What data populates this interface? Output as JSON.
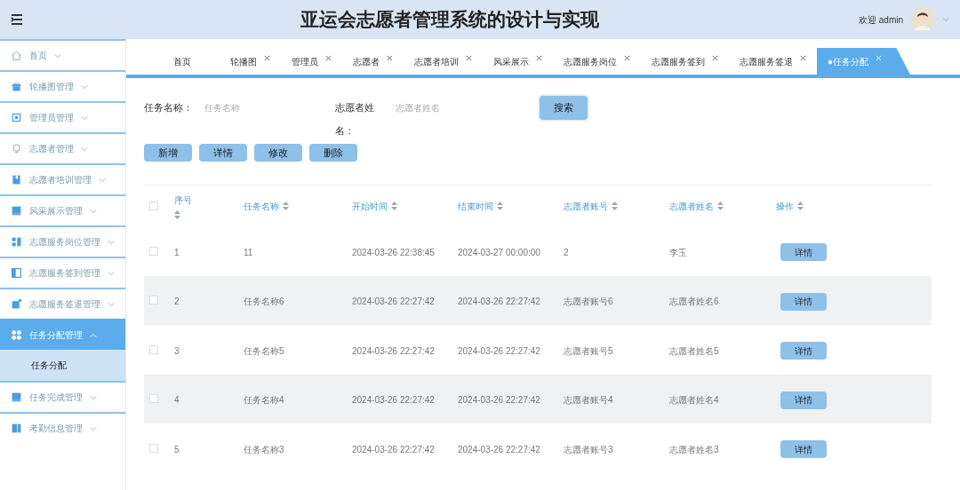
{
  "header": {
    "title": "亚运会志愿者管理系统的设计与实现",
    "welcome": "欢迎 admin"
  },
  "sidebar": {
    "items": [
      {
        "label": "首页",
        "kind": "home",
        "selected": false,
        "expanded": false
      },
      {
        "label": "轮播图管理",
        "kind": "gift",
        "selected": false,
        "expanded": false
      },
      {
        "label": "管理员管理",
        "kind": "chip",
        "selected": false,
        "expanded": false
      },
      {
        "label": "志愿者管理",
        "kind": "bulb",
        "selected": false,
        "expanded": false
      },
      {
        "label": "志愿者培训管理",
        "kind": "bookmark",
        "selected": false,
        "expanded": false
      },
      {
        "label": "风采展示管理",
        "kind": "monitor",
        "selected": false,
        "expanded": false
      },
      {
        "label": "志愿服务岗位管理",
        "kind": "blocks",
        "selected": false,
        "expanded": false
      },
      {
        "label": "志愿服务签到管理",
        "kind": "panel",
        "selected": false,
        "expanded": false
      },
      {
        "label": "志愿服务签退管理",
        "kind": "badge",
        "selected": false,
        "expanded": false
      },
      {
        "label": "任务分配管理",
        "kind": "grid",
        "selected": true,
        "expanded": true,
        "children": [
          {
            "label": "任务分配",
            "selected": true
          }
        ]
      },
      {
        "label": "任务完成管理",
        "kind": "monitor",
        "selected": false,
        "expanded": false
      },
      {
        "label": "考勤信息管理",
        "kind": "book",
        "selected": false,
        "expanded": false
      }
    ]
  },
  "tabs": [
    {
      "label": "首页",
      "closable": false,
      "selected": false
    },
    {
      "label": "轮播图",
      "closable": true,
      "selected": false
    },
    {
      "label": "管理员",
      "closable": true,
      "selected": false
    },
    {
      "label": "志愿者",
      "closable": true,
      "selected": false
    },
    {
      "label": "志愿者培训",
      "closable": true,
      "selected": false
    },
    {
      "label": "风采展示",
      "closable": true,
      "selected": false
    },
    {
      "label": "志愿服务岗位",
      "closable": true,
      "selected": false
    },
    {
      "label": "志愿服务签到",
      "closable": true,
      "selected": false
    },
    {
      "label": "志愿服务签退",
      "closable": true,
      "selected": false
    },
    {
      "label": "●任务分配",
      "closable": true,
      "selected": true
    }
  ],
  "search": {
    "fields": [
      {
        "label": "任务名称：",
        "placeholder": "任务名称"
      },
      {
        "label": "志愿者姓名：",
        "placeholder": "志愿者姓名"
      }
    ],
    "button": "搜索"
  },
  "actions": [
    "新增",
    "详情",
    "修改",
    "删除"
  ],
  "table": {
    "select_all_checked": false,
    "columns": [
      "序号",
      "任务名称",
      "开始时间",
      "结束时间",
      "志愿者账号",
      "志愿者姓名",
      "操作"
    ],
    "rows": [
      {
        "checked": false,
        "cells": [
          "1",
          "11",
          "2024-03-26 22:38:45",
          "2024-03-27 00:00:00",
          "2",
          "李玉"
        ],
        "action": "详情"
      },
      {
        "checked": false,
        "cells": [
          "2",
          "任务名称6",
          "2024-03-26 22:27:42",
          "2024-03-26 22:27:42",
          "志愿者账号6",
          "志愿者姓名6"
        ],
        "action": "详情"
      },
      {
        "checked": false,
        "cells": [
          "3",
          "任务名称5",
          "2024-03-26 22:27:42",
          "2024-03-26 22:27:42",
          "志愿者账号5",
          "志愿者姓名5"
        ],
        "action": "详情"
      },
      {
        "checked": false,
        "cells": [
          "4",
          "任务名称4",
          "2024-03-26 22:27:42",
          "2024-03-26 22:27:42",
          "志愿者账号4",
          "志愿者姓名4"
        ],
        "action": "详情"
      },
      {
        "checked": false,
        "cells": [
          "5",
          "任务名称3",
          "2024-03-26 22:27:42",
          "2024-03-26 22:27:42",
          "志愿者账号3",
          "志愿者姓名3"
        ],
        "action": "详情"
      }
    ]
  }
}
